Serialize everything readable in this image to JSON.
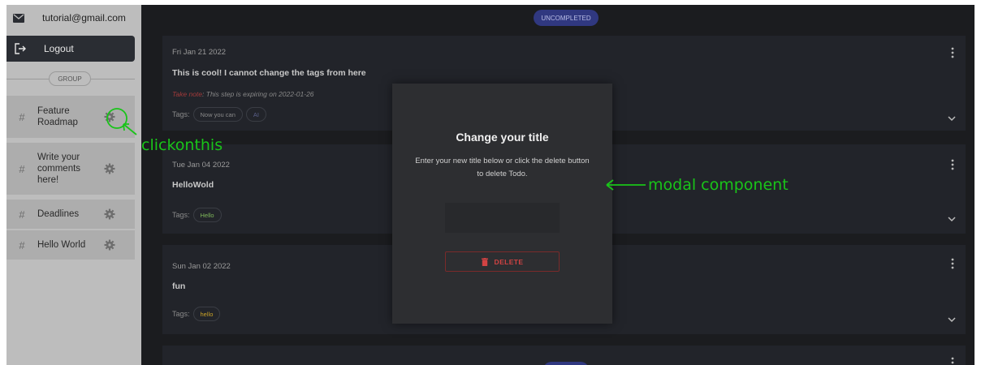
{
  "sidebar": {
    "account": {
      "email": "tutorial@gmail.com",
      "icon": "mail-icon"
    },
    "logout": {
      "label": "Logout",
      "icon": "logout-icon"
    },
    "group_divider": "GROUP",
    "groups": [
      {
        "name": "Feature Roadmap",
        "icon": "hash-icon",
        "settings_icon": "gear-icon"
      },
      {
        "name": "Write your comments here!",
        "icon": "hash-icon",
        "settings_icon": "gear-icon"
      },
      {
        "name": "Deadlines",
        "icon": "hash-icon",
        "settings_icon": "gear-icon"
      },
      {
        "name": "Hello World",
        "icon": "hash-icon",
        "settings_icon": "gear-icon"
      }
    ]
  },
  "main": {
    "status_label": "UNCOMPLETED",
    "todos": [
      {
        "date": "Fri Jan 21 2022",
        "title": "This is cool! I cannot change the tags from here",
        "note_prefix": "Take note",
        "note_text": ": This step is expiring on 2022-01-26",
        "tags_label": "Tags:",
        "tags": [
          "Now you can",
          "AI"
        ]
      },
      {
        "date": "Tue Jan 04 2022",
        "title": "HelloWold",
        "tags_label": "Tags:",
        "tags": [
          "Hello"
        ]
      },
      {
        "date": "Sun Jan 02 2022",
        "title": "fun",
        "tags_label": "Tags:",
        "tags": [
          "hello"
        ]
      }
    ]
  },
  "modal": {
    "title": "Change your title",
    "description": "Enter your new title below or click the delete button to delete Todo.",
    "input_value": "",
    "input_placeholder": "",
    "delete_label": "DELETE",
    "delete_icon": "trash-icon"
  },
  "annotations": {
    "click_hint": "clickonthis",
    "modal_hint": "modal component"
  },
  "colors": {
    "sidebar_bg": "#bdbdbd",
    "main_bg": "#1b1c1f",
    "card_bg": "#22242a",
    "modal_bg": "#2d2e31",
    "accent_blue": "#303880",
    "danger": "#d14343",
    "annotation_green": "#19c419",
    "tag_green": "#7fb85a",
    "tag_yellow": "#c9a227"
  }
}
